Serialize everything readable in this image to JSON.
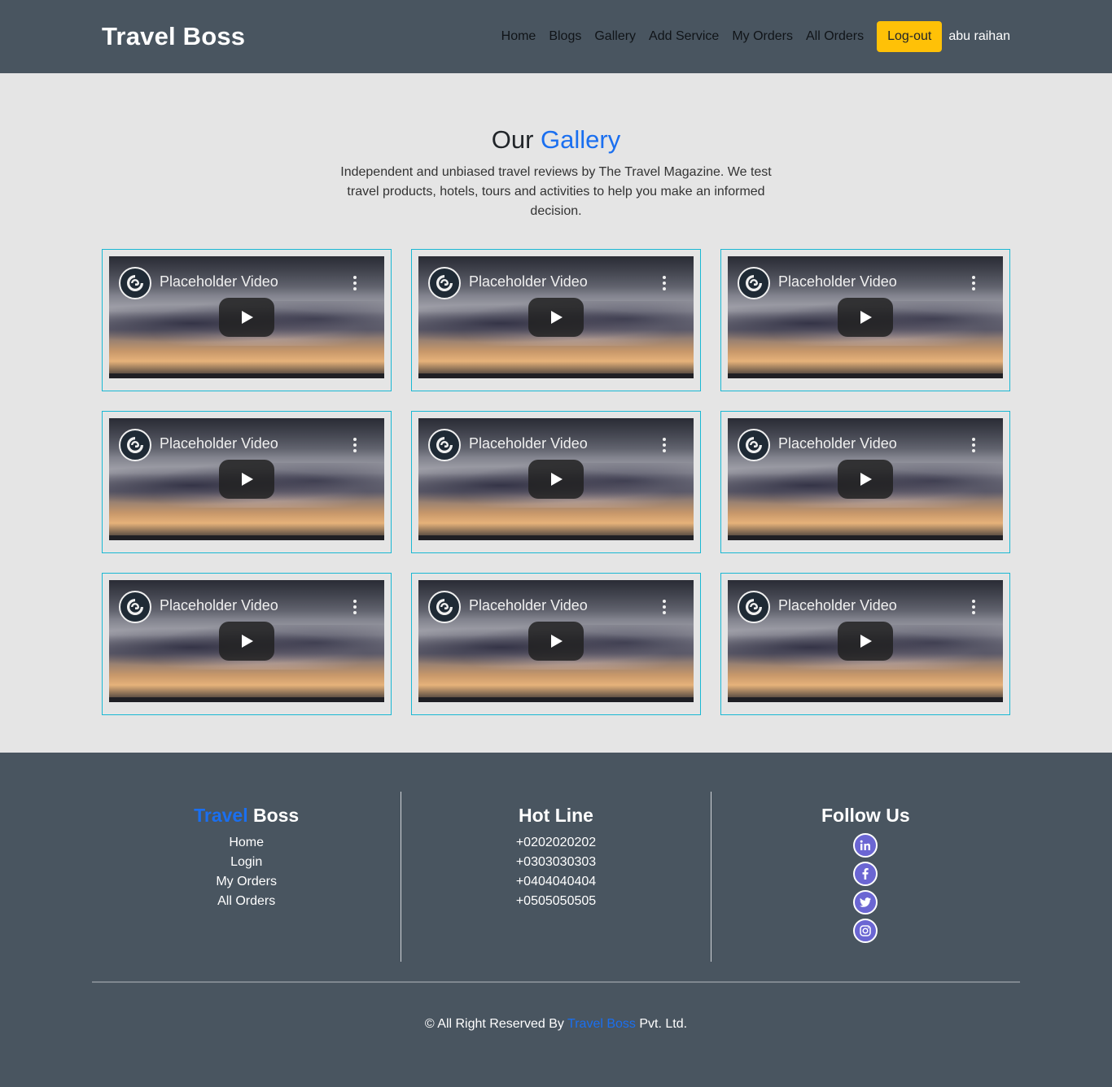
{
  "header": {
    "brand": "Travel Boss",
    "nav": [
      "Home",
      "Blogs",
      "Gallery",
      "Add Service",
      "My Orders",
      "All Orders"
    ],
    "logout_label": "Log-out",
    "user_name": "abu raihan"
  },
  "gallery": {
    "title_plain": "Our",
    "title_accent": "Gallery",
    "subtitle": "Independent and unbiased travel reviews by The Travel Magazine. We test travel products, hotels, tours and activities to help you make an informed decision.",
    "videos": [
      {
        "title": "Placeholder Video"
      },
      {
        "title": "Placeholder Video"
      },
      {
        "title": "Placeholder Video"
      },
      {
        "title": "Placeholder Video"
      },
      {
        "title": "Placeholder Video"
      },
      {
        "title": "Placeholder Video"
      },
      {
        "title": "Placeholder Video"
      },
      {
        "title": "Placeholder Video"
      },
      {
        "title": "Placeholder Video"
      }
    ]
  },
  "footer": {
    "brand_accent": "Travel",
    "brand_plain": "Boss",
    "links": [
      "Home",
      "Login",
      "My Orders",
      "All Orders"
    ],
    "hotline_title": "Hot Line",
    "phones": [
      "+0202020202",
      "+0303030303",
      "+0404040404",
      "+0505050505"
    ],
    "follow_title": "Follow Us",
    "social_icons": [
      "linkedin-icon",
      "facebook-icon",
      "twitter-icon",
      "instagram-icon"
    ],
    "copyright_prefix": "© All Right Reserved By",
    "copyright_brand": "Travel Boss",
    "copyright_suffix": "Pvt. Ltd."
  },
  "colors": {
    "header_bg": "#495560",
    "accent_blue": "#1a6ff0",
    "logout_yellow": "#ffc107",
    "card_border": "#1ab8d3",
    "social_purple": "#6b66d3"
  }
}
